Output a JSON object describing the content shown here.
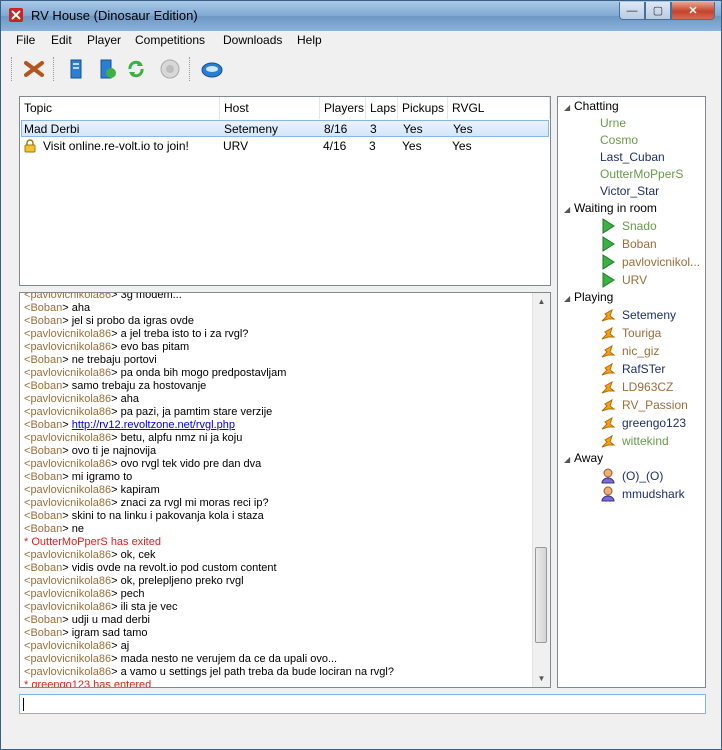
{
  "window": {
    "title": "RV House (Dinosaur Edition)"
  },
  "menu": [
    "File",
    "Edit",
    "Player",
    "Competitions",
    "Downloads",
    "Help"
  ],
  "toolbar": {
    "buttons": [
      "disconnect-icon",
      "host-game-icon",
      "join-game-icon",
      "refresh-icon",
      "disabled-icon",
      "launch-icon"
    ]
  },
  "games": {
    "headers": [
      "Topic",
      "Host",
      "Players",
      "Laps",
      "Pickups",
      "RVGL"
    ],
    "rows": [
      {
        "topic": "Mad Derbi",
        "host": "Setemeny",
        "players": "8/16",
        "laps": "3",
        "pickups": "Yes",
        "rvgl": "Yes",
        "selected": true
      },
      {
        "topic": "Visit online.re-volt.io to join!",
        "host": "URV",
        "players": "4/16",
        "laps": "3",
        "pickups": "Yes",
        "rvgl": "Yes",
        "locked": true
      }
    ]
  },
  "chat": [
    {
      "type": "msg",
      "nick": "pavlovicnikola86",
      "text": "3g modem..."
    },
    {
      "type": "msg",
      "nick": "Boban",
      "text": "aha"
    },
    {
      "type": "msg",
      "nick": "Boban",
      "text": "jel si probo da igras ovde"
    },
    {
      "type": "msg",
      "nick": "pavlovicnikola86",
      "text": "a jel treba isto to i za rvgl?"
    },
    {
      "type": "msg",
      "nick": "pavlovicnikola86",
      "text": "evo bas pitam"
    },
    {
      "type": "msg",
      "nick": "Boban",
      "text": "ne trebaju portovi"
    },
    {
      "type": "msg",
      "nick": "pavlovicnikola86",
      "text": "pa onda bih mogo predpostavljam"
    },
    {
      "type": "msg",
      "nick": "Boban",
      "text": "samo trebaju za hostovanje"
    },
    {
      "type": "msg",
      "nick": "pavlovicnikola86",
      "text": "aha"
    },
    {
      "type": "msg",
      "nick": "pavlovicnikola86",
      "text": "pa pazi, ja pamtim stare verzije"
    },
    {
      "type": "link",
      "nick": "Boban",
      "text": "http://rv12.revoltzone.net/rvgl.php"
    },
    {
      "type": "msg",
      "nick": "pavlovicnikola86",
      "text": "betu, alpfu nmz ni ja koju"
    },
    {
      "type": "msg",
      "nick": "Boban",
      "text": "ovo ti je najnovija"
    },
    {
      "type": "msg",
      "nick": "pavlovicnikola86",
      "text": "ovo rvgl tek vido pre dan dva"
    },
    {
      "type": "msg",
      "nick": "Boban",
      "text": "mi igramo to"
    },
    {
      "type": "msg",
      "nick": "pavlovicnikola86",
      "text": "kapiram"
    },
    {
      "type": "msg",
      "nick": "pavlovicnikola86",
      "text": "znaci za rvgl mi moras reci ip?"
    },
    {
      "type": "msg",
      "nick": "Boban",
      "text": "skini to na linku i pakovanja kola i staza"
    },
    {
      "type": "msg",
      "nick": "Boban",
      "text": "ne"
    },
    {
      "type": "sys",
      "text": "* OutterMoPperS has exited"
    },
    {
      "type": "msg",
      "nick": "pavlovicnikola86",
      "text": "ok, cek"
    },
    {
      "type": "msg",
      "nick": "Boban",
      "text": "vidis ovde na revolt.io pod custom content"
    },
    {
      "type": "msg",
      "nick": "pavlovicnikola86",
      "text": "ok, prelepljeno preko rvgl"
    },
    {
      "type": "msg",
      "nick": "pavlovicnikola86",
      "text": "pech"
    },
    {
      "type": "msg",
      "nick": "pavlovicnikola86",
      "text": "ili sta je vec"
    },
    {
      "type": "msg",
      "nick": "Boban",
      "text": "udji u mad derbi"
    },
    {
      "type": "msg",
      "nick": "Boban",
      "text": "igram sad tamo"
    },
    {
      "type": "msg",
      "nick": "pavlovicnikola86",
      "text": "aj"
    },
    {
      "type": "msg",
      "nick": "pavlovicnikola86",
      "text": "mada nesto ne verujem da ce da upali ovo..."
    },
    {
      "type": "msg",
      "nick": "pavlovicnikola86",
      "text": "a vamo u settings jel path treba da bude lociran na rvgl?"
    },
    {
      "type": "sys",
      "text": "* greengo123 has entered"
    }
  ],
  "users": {
    "groups": [
      {
        "label": "Chatting",
        "users": [
          {
            "name": "Urne",
            "color": "#6a9a4a",
            "icon": "none"
          },
          {
            "name": "Cosmo",
            "color": "#6a9a4a",
            "icon": "none"
          },
          {
            "name": "Last_Cuban",
            "color": "#1c2f6e",
            "icon": "none"
          },
          {
            "name": "OutterMoPperS",
            "color": "#6a9a4a",
            "icon": "none"
          },
          {
            "name": "Victor_Star",
            "color": "#1c2f6e",
            "icon": "none"
          }
        ]
      },
      {
        "label": "Waiting in room",
        "users": [
          {
            "name": "Snado",
            "color": "#6a9a4a",
            "icon": "play-icon"
          },
          {
            "name": "Boban",
            "color": "#9d6e3a",
            "icon": "play-icon"
          },
          {
            "name": "pavlovicnikol...",
            "color": "#9d6e3a",
            "icon": "play-icon"
          },
          {
            "name": "URV",
            "color": "#9d6e3a",
            "icon": "play-icon"
          }
        ]
      },
      {
        "label": "Playing",
        "users": [
          {
            "name": "Setemeny",
            "color": "#1c2f6e",
            "icon": "racing-icon"
          },
          {
            "name": "Touriga",
            "color": "#9d6e3a",
            "icon": "racing-icon"
          },
          {
            "name": "nic_giz",
            "color": "#9d6e3a",
            "icon": "racing-icon"
          },
          {
            "name": "RafSTer",
            "color": "#1c2f6e",
            "icon": "racing-icon"
          },
          {
            "name": "LD963CZ",
            "color": "#9d6e3a",
            "icon": "racing-icon"
          },
          {
            "name": "RV_Passion",
            "color": "#9d6e3a",
            "icon": "racing-icon"
          },
          {
            "name": "greengo123",
            "color": "#1c2f6e",
            "icon": "racing-icon"
          },
          {
            "name": "wittekind",
            "color": "#6a9a4a",
            "icon": "racing-icon"
          }
        ]
      },
      {
        "label": "Away",
        "users": [
          {
            "name": "(O)_(O)",
            "color": "#1c2f6e",
            "icon": "away-icon"
          },
          {
            "name": "mmudshark",
            "color": "#1c2f6e",
            "icon": "away-icon"
          }
        ]
      }
    ]
  },
  "input": {
    "value": ""
  }
}
